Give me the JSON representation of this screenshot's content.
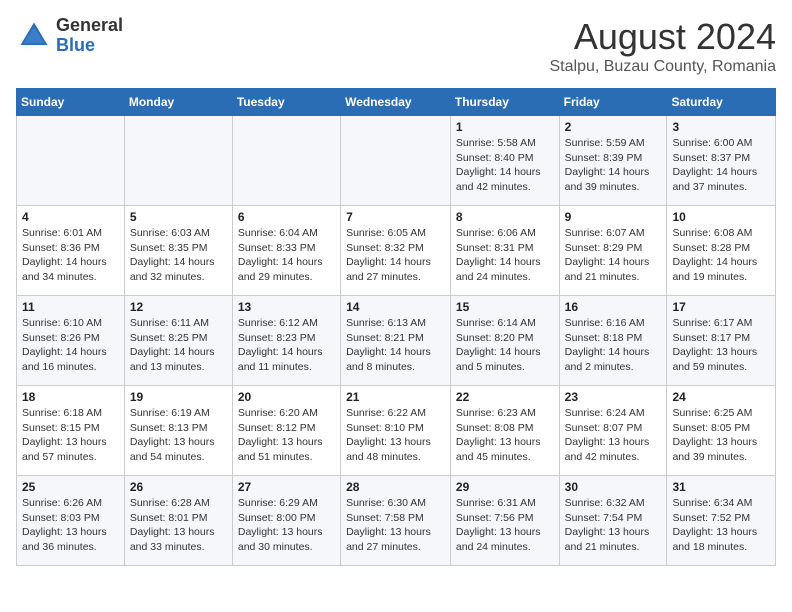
{
  "logo": {
    "general": "General",
    "blue": "Blue"
  },
  "title": "August 2024",
  "subtitle": "Stalpu, Buzau County, Romania",
  "days": [
    "Sunday",
    "Monday",
    "Tuesday",
    "Wednesday",
    "Thursday",
    "Friday",
    "Saturday"
  ],
  "weeks": [
    [
      {
        "date": "",
        "info": ""
      },
      {
        "date": "",
        "info": ""
      },
      {
        "date": "",
        "info": ""
      },
      {
        "date": "",
        "info": ""
      },
      {
        "date": "1",
        "info": "Sunrise: 5:58 AM\nSunset: 8:40 PM\nDaylight: 14 hours and 42 minutes."
      },
      {
        "date": "2",
        "info": "Sunrise: 5:59 AM\nSunset: 8:39 PM\nDaylight: 14 hours and 39 minutes."
      },
      {
        "date": "3",
        "info": "Sunrise: 6:00 AM\nSunset: 8:37 PM\nDaylight: 14 hours and 37 minutes."
      }
    ],
    [
      {
        "date": "4",
        "info": "Sunrise: 6:01 AM\nSunset: 8:36 PM\nDaylight: 14 hours and 34 minutes."
      },
      {
        "date": "5",
        "info": "Sunrise: 6:03 AM\nSunset: 8:35 PM\nDaylight: 14 hours and 32 minutes."
      },
      {
        "date": "6",
        "info": "Sunrise: 6:04 AM\nSunset: 8:33 PM\nDaylight: 14 hours and 29 minutes."
      },
      {
        "date": "7",
        "info": "Sunrise: 6:05 AM\nSunset: 8:32 PM\nDaylight: 14 hours and 27 minutes."
      },
      {
        "date": "8",
        "info": "Sunrise: 6:06 AM\nSunset: 8:31 PM\nDaylight: 14 hours and 24 minutes."
      },
      {
        "date": "9",
        "info": "Sunrise: 6:07 AM\nSunset: 8:29 PM\nDaylight: 14 hours and 21 minutes."
      },
      {
        "date": "10",
        "info": "Sunrise: 6:08 AM\nSunset: 8:28 PM\nDaylight: 14 hours and 19 minutes."
      }
    ],
    [
      {
        "date": "11",
        "info": "Sunrise: 6:10 AM\nSunset: 8:26 PM\nDaylight: 14 hours and 16 minutes."
      },
      {
        "date": "12",
        "info": "Sunrise: 6:11 AM\nSunset: 8:25 PM\nDaylight: 14 hours and 13 minutes."
      },
      {
        "date": "13",
        "info": "Sunrise: 6:12 AM\nSunset: 8:23 PM\nDaylight: 14 hours and 11 minutes."
      },
      {
        "date": "14",
        "info": "Sunrise: 6:13 AM\nSunset: 8:21 PM\nDaylight: 14 hours and 8 minutes."
      },
      {
        "date": "15",
        "info": "Sunrise: 6:14 AM\nSunset: 8:20 PM\nDaylight: 14 hours and 5 minutes."
      },
      {
        "date": "16",
        "info": "Sunrise: 6:16 AM\nSunset: 8:18 PM\nDaylight: 14 hours and 2 minutes."
      },
      {
        "date": "17",
        "info": "Sunrise: 6:17 AM\nSunset: 8:17 PM\nDaylight: 13 hours and 59 minutes."
      }
    ],
    [
      {
        "date": "18",
        "info": "Sunrise: 6:18 AM\nSunset: 8:15 PM\nDaylight: 13 hours and 57 minutes."
      },
      {
        "date": "19",
        "info": "Sunrise: 6:19 AM\nSunset: 8:13 PM\nDaylight: 13 hours and 54 minutes."
      },
      {
        "date": "20",
        "info": "Sunrise: 6:20 AM\nSunset: 8:12 PM\nDaylight: 13 hours and 51 minutes."
      },
      {
        "date": "21",
        "info": "Sunrise: 6:22 AM\nSunset: 8:10 PM\nDaylight: 13 hours and 48 minutes."
      },
      {
        "date": "22",
        "info": "Sunrise: 6:23 AM\nSunset: 8:08 PM\nDaylight: 13 hours and 45 minutes."
      },
      {
        "date": "23",
        "info": "Sunrise: 6:24 AM\nSunset: 8:07 PM\nDaylight: 13 hours and 42 minutes."
      },
      {
        "date": "24",
        "info": "Sunrise: 6:25 AM\nSunset: 8:05 PM\nDaylight: 13 hours and 39 minutes."
      }
    ],
    [
      {
        "date": "25",
        "info": "Sunrise: 6:26 AM\nSunset: 8:03 PM\nDaylight: 13 hours and 36 minutes."
      },
      {
        "date": "26",
        "info": "Sunrise: 6:28 AM\nSunset: 8:01 PM\nDaylight: 13 hours and 33 minutes."
      },
      {
        "date": "27",
        "info": "Sunrise: 6:29 AM\nSunset: 8:00 PM\nDaylight: 13 hours and 30 minutes."
      },
      {
        "date": "28",
        "info": "Sunrise: 6:30 AM\nSunset: 7:58 PM\nDaylight: 13 hours and 27 minutes."
      },
      {
        "date": "29",
        "info": "Sunrise: 6:31 AM\nSunset: 7:56 PM\nDaylight: 13 hours and 24 minutes."
      },
      {
        "date": "30",
        "info": "Sunrise: 6:32 AM\nSunset: 7:54 PM\nDaylight: 13 hours and 21 minutes."
      },
      {
        "date": "31",
        "info": "Sunrise: 6:34 AM\nSunset: 7:52 PM\nDaylight: 13 hours and 18 minutes."
      }
    ]
  ]
}
